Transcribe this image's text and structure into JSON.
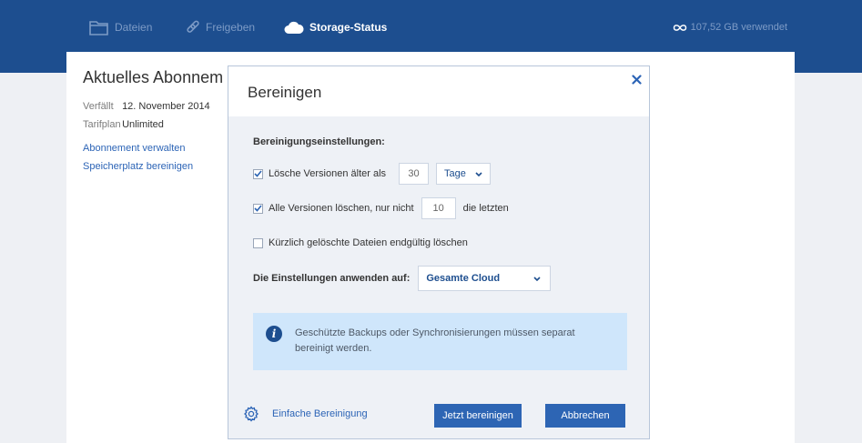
{
  "nav": {
    "files_label": "Dateien",
    "share_label": "Freigeben",
    "status_label": "Storage-Status",
    "usage_label": "107,52 GB verwendet"
  },
  "subscription": {
    "title": "Aktuelles Abonnem",
    "expires_label": "Verfällt",
    "expires_value": "12. November 2014",
    "plan_label": "Tarifplan",
    "plan_value": "Unlimited",
    "manage_link": "Abonnement verwalten",
    "cleanup_link": "Speicherplatz bereinigen"
  },
  "dialog": {
    "title": "Bereinigen",
    "close_glyph": "✕",
    "section_title": "Bereinigungseinstellungen:",
    "option1": {
      "label": "Lösche Versionen älter als",
      "checked": true,
      "value": "30",
      "unit": "Tage"
    },
    "option2": {
      "label": "Alle Versionen löschen, nur nicht",
      "checked": true,
      "value": "10",
      "suffix": "die letzten"
    },
    "option3": {
      "label": "Kürzlich gelöschte Dateien endgültig löschen",
      "checked": false
    },
    "apply_label": "Die Einstellungen anwenden auf:",
    "apply_value": "Gesamte Cloud",
    "info_text": "Geschützte Backups oder Synchronisierungen müssen separat bereinigt werden.",
    "simple_cleanup_link": "Einfache Bereinigung",
    "primary_button": "Jetzt bereinigen",
    "cancel_button": "Abbrechen"
  },
  "colors": {
    "nav_bg": "#1d4e8f",
    "accent": "#2d65b4",
    "info_bg": "#cfe6fb"
  },
  "icons": [
    "folder-icon",
    "link-icon",
    "cloud-icon",
    "infinity-icon",
    "close-icon",
    "checkmark-icon",
    "chevron-down-icon",
    "info-icon",
    "gear-icon"
  ]
}
